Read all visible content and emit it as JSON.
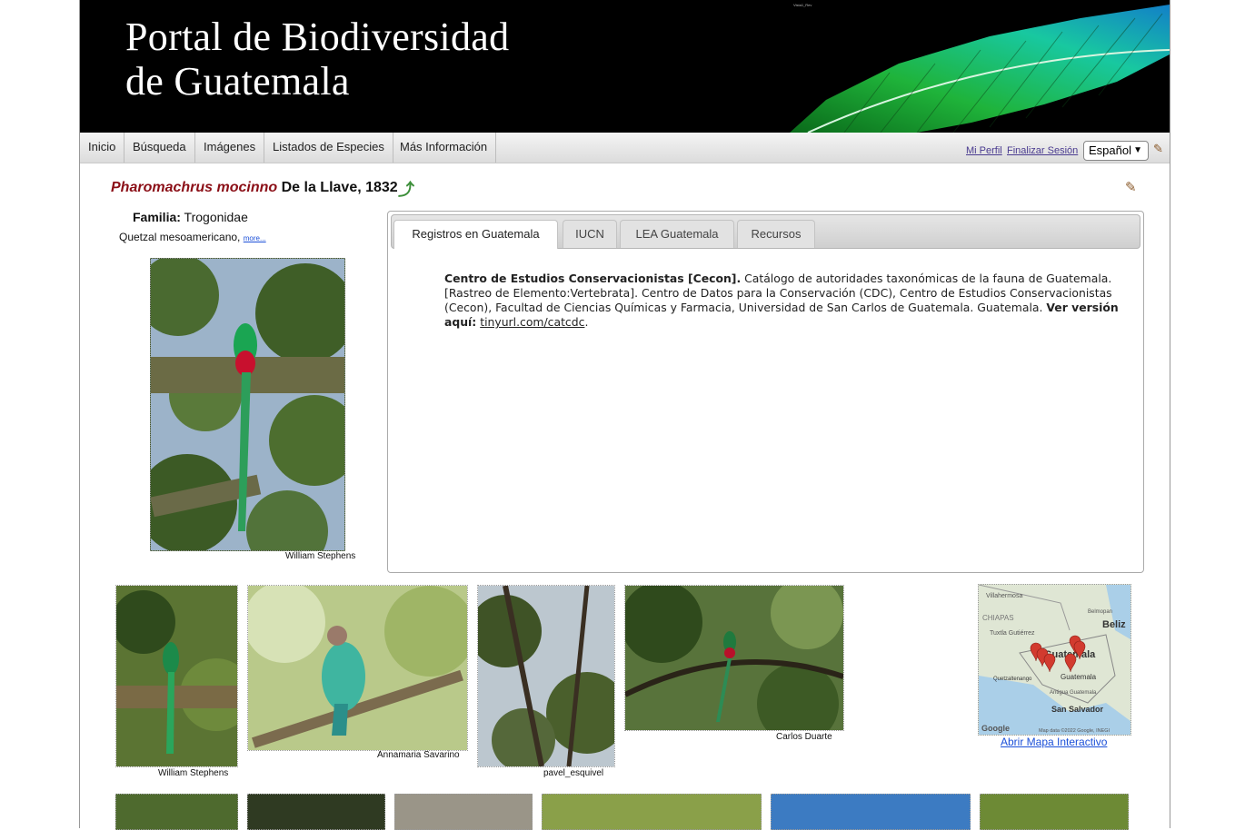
{
  "banner": {
    "title_line1": "Portal de Biodiversidad",
    "title_line2": "de Guatemala",
    "tiny_text": "Vista1_Rev"
  },
  "nav": {
    "items": [
      "Inicio",
      "Búsqueda",
      "Imágenes",
      "Listados de Especies",
      "Más Información"
    ],
    "profile_link": "Mi Perfil",
    "logout_link": "Finalizar Sesión",
    "language": "Español"
  },
  "taxon": {
    "scientific_name": "Pharomachrus mocinno",
    "author": "De la Llave, 1832",
    "family_label": "Familia:",
    "family": "Trogonidae",
    "common_name": "Quetzal mesoamericano,",
    "more_link": "more..."
  },
  "main_image": {
    "credit": "William Stephens"
  },
  "tabs": {
    "items": [
      "Registros en Guatemala",
      "IUCN",
      "LEA Guatemala",
      "Recursos"
    ],
    "content": {
      "source_bold": "Centro de Estudios Conservacionistas [Cecon].",
      "body": " Catálogo de autoridades taxonómicas de la fauna de Guatemala. [Rastreo de Elemento:Vertebrata]. Centro de Datos para la Conservación (CDC), Centro de Estudios Conservacionistas (Cecon), Facultad de Ciencias Químicas y Farmacia, Universidad de San Carlos de Guatemala. Guatemala. ",
      "version_label": "Ver versión aquí:",
      "link": "tinyurl.com/catcdc",
      "end": "."
    }
  },
  "gallery": {
    "credits": [
      "William Stephens",
      "Annamaria Savarino",
      "pavel_esquivel",
      "Carlos Duarte"
    ]
  },
  "map": {
    "labels": [
      "Villahermosa",
      "CHIAPAS",
      "Tuxtla Gutiérrez",
      "Beliz",
      "Belmopan",
      "Guatemala",
      "Quetzaltenango",
      "Guatemala",
      "Antigua Guatemala",
      "San Salvador",
      "Google",
      "Map data ©2022 Google, INEGI"
    ],
    "link": "Abrir Mapa Interactivo"
  },
  "colors": {
    "genus": "#8b0f17",
    "link": "#1a4fd8",
    "nav_link": "#4a3b90"
  },
  "icons": {
    "edit": "pencil-icon",
    "go_up": "green-arrow-icon",
    "map_marker": "map-marker-icon"
  }
}
